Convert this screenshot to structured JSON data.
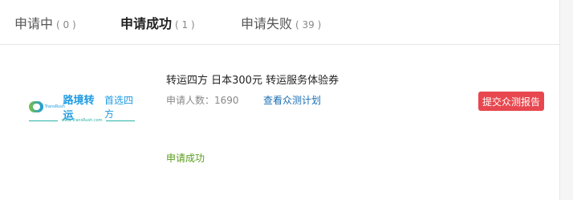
{
  "tabs": [
    {
      "label": "申请中",
      "count": "( 0 )"
    },
    {
      "label": "申请成功",
      "count": "( 1 )"
    },
    {
      "label": "申请失败",
      "count": "( 39 )"
    }
  ],
  "item": {
    "logo": {
      "text_en": "TransRush",
      "text_cn": "路境转运",
      "slogan": "首选四方",
      "url": "www.TransRush.com"
    },
    "title": "转运四方 日本300元 转运服务体验券",
    "applicants": "申请人数：1690",
    "plan_link": "查看众测计划",
    "submit_button": "提交众测报告",
    "status": "申请成功"
  },
  "colors": {
    "accent_red": "#e8474f",
    "link_blue": "#1a6fb3",
    "success_green": "#5a9e1e"
  }
}
